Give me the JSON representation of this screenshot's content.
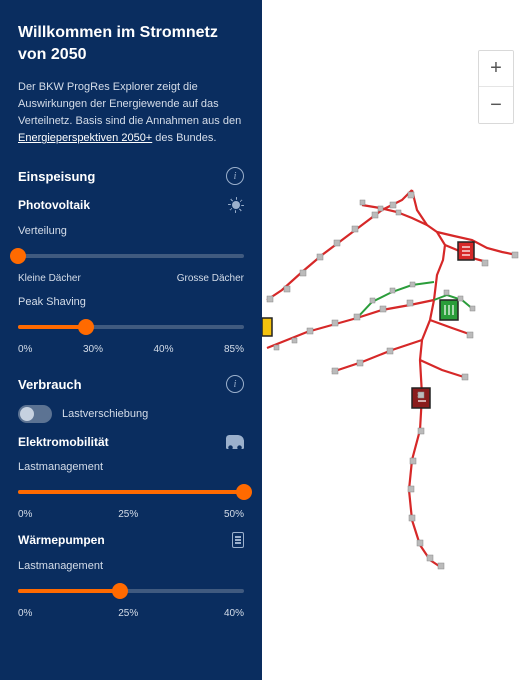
{
  "title": "Willkommen im Stromnetz von 2050",
  "intro": {
    "part1": "Der BKW ProgRes Explorer zeigt die Auswirkungen der Energiewende auf das Verteilnetz. Basis sind die Annahmen aus den ",
    "link": "Energieperspektiven 2050+",
    "part2": " des Bundes."
  },
  "sections": {
    "feed_in": {
      "label": "Einspeisung"
    },
    "pv": {
      "label": "Photovoltaik"
    },
    "distribution": {
      "label": "Verteilung",
      "ticks": {
        "left": "Kleine Dächer",
        "right": "Grosse Dächer"
      },
      "value_pct": 0
    },
    "peak_shaving": {
      "label": "Peak Shaving",
      "ticks": [
        "0%",
        "30%",
        "40%",
        "85%"
      ],
      "value_pct": 30
    },
    "consumption": {
      "label": "Verbrauch"
    },
    "load_shift": {
      "label": "Lastverschiebung",
      "on": false
    },
    "emobility": {
      "label": "Elektromobilität",
      "sublabel": "Lastmanagement",
      "ticks": [
        "0%",
        "25%",
        "50%"
      ],
      "value_pct": 100
    },
    "heatpumps": {
      "label": "Wärmepumpen",
      "sublabel": "Lastmanagement",
      "ticks": [
        "0%",
        "25%",
        "40%"
      ],
      "value_pct": 45
    }
  },
  "zoom": {
    "in": "+",
    "out": "−"
  }
}
